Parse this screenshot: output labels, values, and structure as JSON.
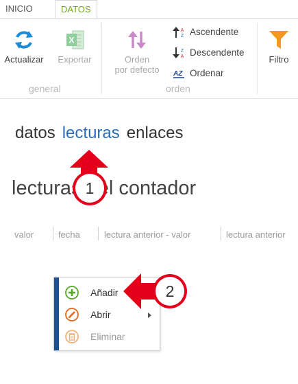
{
  "tabs": {
    "inicio": "INICIO",
    "datos": "DATOS"
  },
  "ribbon": {
    "actualizar": "Actualizar",
    "exportar": "Exportar",
    "group_general": "general",
    "orden_line1": "Orden",
    "orden_line2": "por defecto",
    "ascendente": "Ascendente",
    "descendente": "Descendente",
    "ordenar": "Ordenar",
    "group_orden": "orden",
    "filtro": "Filtro"
  },
  "nav": {
    "datos": "datos",
    "lecturas": "lecturas",
    "enlaces": "enlaces"
  },
  "heading": "lecturas del contador",
  "columns": [
    "valor",
    "fecha",
    "lectura anterior - valor",
    "lectura anterior"
  ],
  "menu": {
    "anadir": "Añadir",
    "abrir": "Abrir",
    "eliminar": "Eliminar"
  },
  "callouts": {
    "one": "1",
    "two": "2"
  },
  "colors": {
    "accent_green": "#71a71c",
    "link_blue": "#2a6ebb",
    "callout_red": "#e3001b",
    "menu_bar": "#1d4f91"
  }
}
